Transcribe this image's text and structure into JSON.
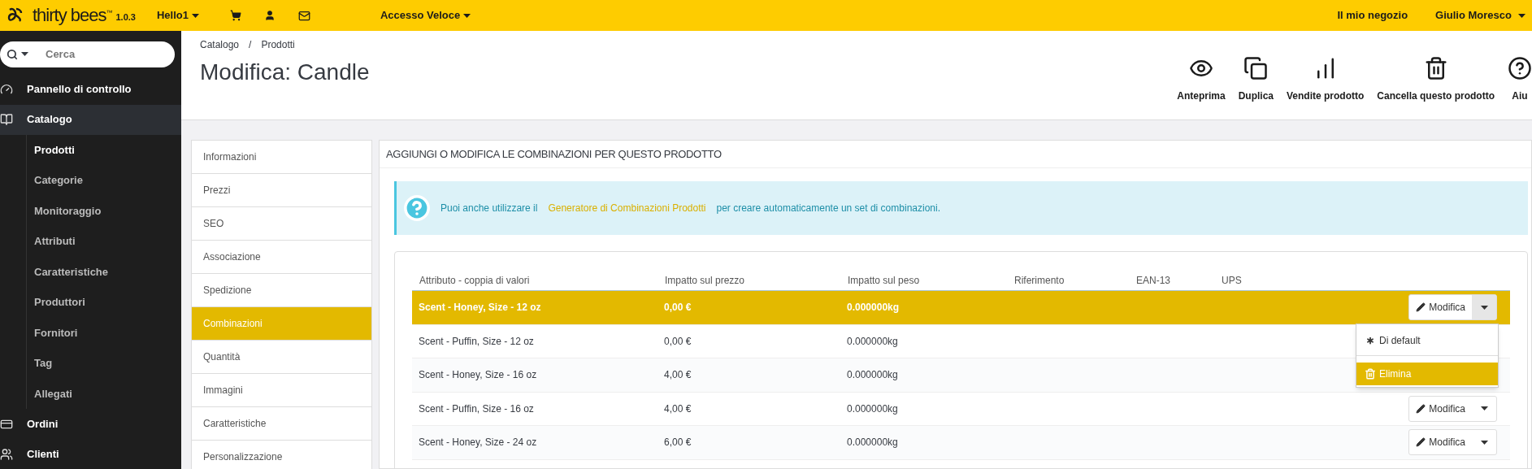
{
  "topbar": {
    "brand": "thirty bees",
    "trademark": "™",
    "version": "1.0.3",
    "shop_menu": "Hello1",
    "quick_access": "Accesso Veloce",
    "my_shop": "Il mio negozio",
    "user": "Giulio Moresco"
  },
  "sidebar": {
    "search": {
      "placeholder": "Cerca"
    },
    "items": [
      {
        "label": "Pannello di controllo",
        "selected": false
      },
      {
        "label": "Catalogo",
        "selected": true,
        "children": [
          {
            "label": "Prodotti",
            "selected": true
          },
          {
            "label": "Categorie",
            "selected": false
          },
          {
            "label": "Monitoraggio",
            "selected": false
          },
          {
            "label": "Attributi",
            "selected": false
          },
          {
            "label": "Caratteristiche",
            "selected": false
          },
          {
            "label": "Produttori",
            "selected": false
          },
          {
            "label": "Fornitori",
            "selected": false
          },
          {
            "label": "Tag",
            "selected": false
          },
          {
            "label": "Allegati",
            "selected": false
          }
        ]
      },
      {
        "label": "Ordini",
        "selected": false
      },
      {
        "label": "Clienti",
        "selected": false
      }
    ]
  },
  "breadcrumb": [
    "Catalogo",
    "/",
    "Prodotti"
  ],
  "page_title": "Modifica: Candle",
  "toolbar": [
    "Anteprima",
    "Duplica",
    "Vendite prodotto",
    "Cancella questo prodotto",
    "Aiu"
  ],
  "product_tabs": [
    {
      "label": "Informazioni",
      "selected": false
    },
    {
      "label": "Prezzi",
      "selected": false
    },
    {
      "label": "SEO",
      "selected": false
    },
    {
      "label": "Associazione",
      "selected": false
    },
    {
      "label": "Spedizione",
      "selected": false
    },
    {
      "label": "Combinazioni",
      "selected": true
    },
    {
      "label": "Quantità",
      "selected": false
    },
    {
      "label": "Immagini",
      "selected": false
    },
    {
      "label": "Caratteristiche",
      "selected": false
    },
    {
      "label": "Personalizzazione",
      "selected": false
    }
  ],
  "panel": {
    "heading": "AGGIUNGI O MODIFICA LE COMBINAZIONI PER QUESTO PRODOTTO",
    "alert": {
      "before": "Puoi anche utilizzare il",
      "link": "Generatore di Combinazioni Prodotti",
      "after": "per creare automaticamente un set di combinazioni."
    },
    "table": {
      "columns": [
        "Attributo - coppia di valori",
        "Impatto sul prezzo",
        "Impatto sul peso",
        "Riferimento",
        "EAN-13",
        "UPS"
      ],
      "rows": [
        {
          "cells": [
            "Scent - Honey, Size - 12 oz",
            "0,00 €",
            "0.000000kg"
          ],
          "selected": true,
          "action": "Modifica",
          "menu_open": true
        },
        {
          "cells": [
            "Scent - Puffin, Size - 12 oz",
            "0,00 €",
            "0.000000kg"
          ],
          "selected": false
        },
        {
          "cells": [
            "Scent - Honey, Size - 16 oz",
            "4,00 €",
            "0.000000kg"
          ],
          "selected": false
        },
        {
          "cells": [
            "Scent - Puffin, Size - 16 oz",
            "4,00 €",
            "0.000000kg"
          ],
          "selected": false,
          "action": "Modifica",
          "menu_open": false
        },
        {
          "cells": [
            "Scent - Honey, Size - 24 oz",
            "6,00 €",
            "0.000000kg"
          ],
          "selected": false,
          "action": "Modifica",
          "menu_open": false
        }
      ]
    },
    "row_menu": [
      {
        "label": "Di default",
        "selected": false
      },
      {
        "label": "Elimina",
        "selected": true
      }
    ]
  }
}
